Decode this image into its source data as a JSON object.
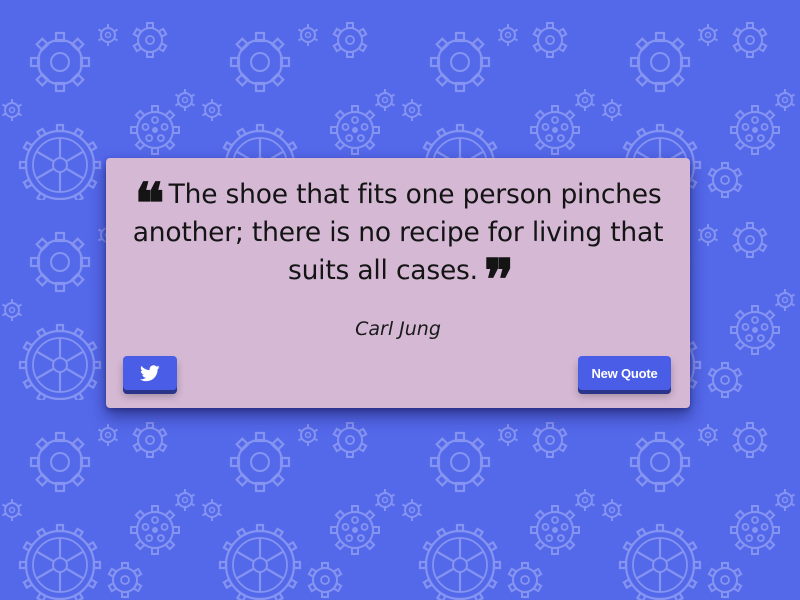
{
  "quote": {
    "open_mark": "❝",
    "text": "The shoe that fits one person pinches another; there is no recipe for living that suits all cases.",
    "close_mark": "❞",
    "author": "Carl Jung"
  },
  "buttons": {
    "tweet_icon": "twitter-bird",
    "new_quote_label": "New Quote"
  },
  "colors": {
    "background": "#5468ea",
    "gear_stroke": "#8e9bf2",
    "card": "#d4b8d4",
    "button": "#4a5de6",
    "text": "#141414"
  }
}
